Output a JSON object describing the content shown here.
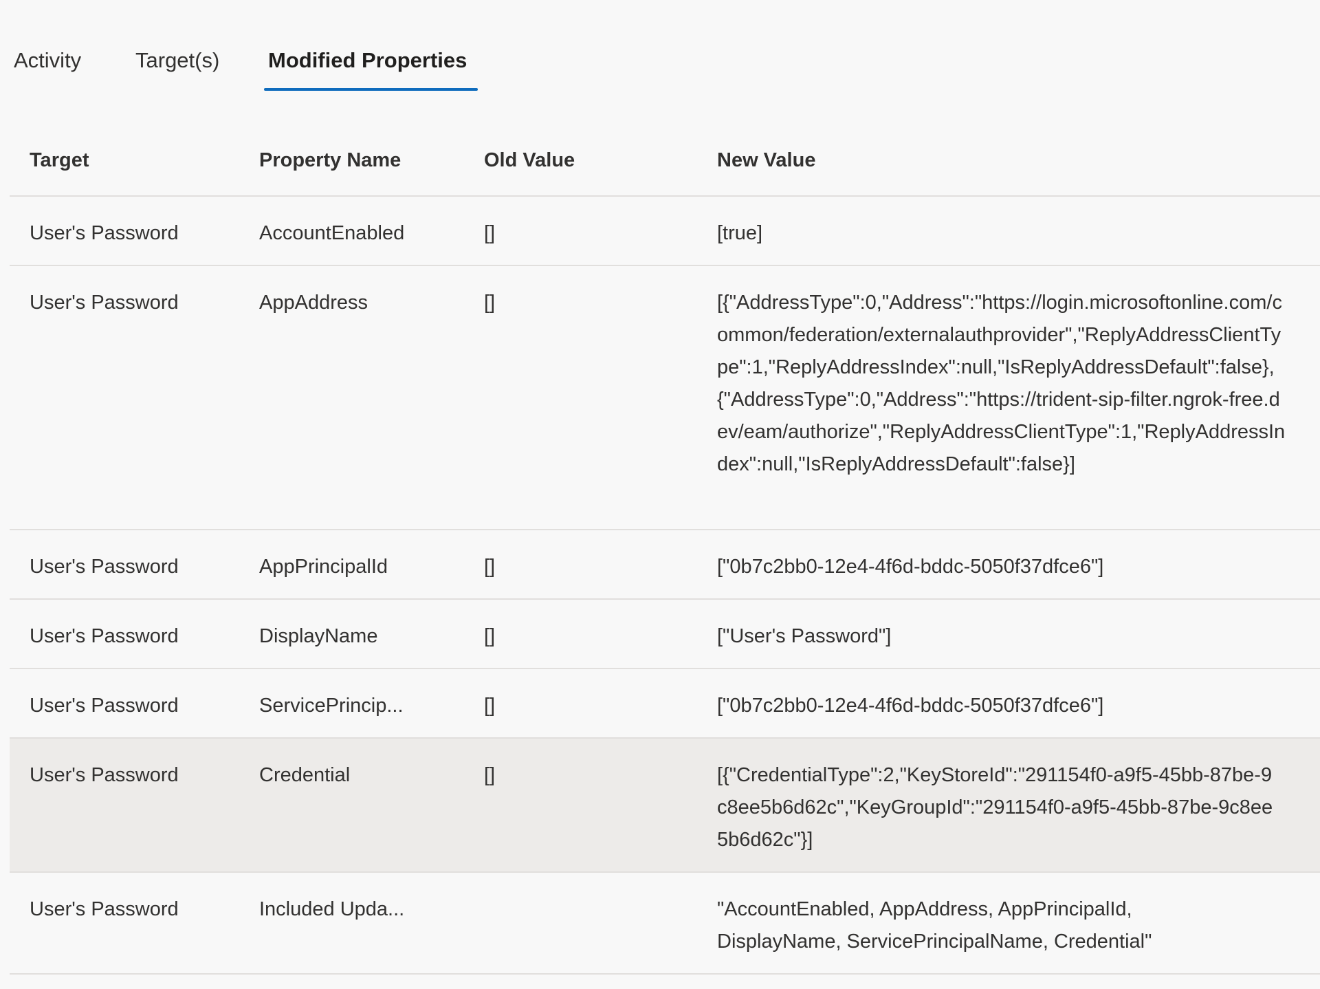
{
  "tabs": [
    {
      "label": "Activity",
      "active": false
    },
    {
      "label": "Target(s)",
      "active": false
    },
    {
      "label": "Modified Properties",
      "active": true
    }
  ],
  "table": {
    "headers": {
      "target": "Target",
      "property_name": "Property Name",
      "old_value": "Old Value",
      "new_value": "New Value"
    },
    "rows": [
      {
        "target": "User's Password",
        "property_name": "AccountEnabled",
        "old_value": "[]",
        "new_value": "[true]"
      },
      {
        "target": "User's Password",
        "property_name": "AppAddress",
        "old_value": "[]",
        "new_value": "[{\"AddressType\":0,\"Address\":\"https://login.microsoftonline.com/common/federation/externalauthprovider\",\"ReplyAddressClientType\":1,\"ReplyAddressIndex\":null,\"IsReplyAddressDefault\":false},{\"AddressType\":0,\"Address\":\"https://trident-sip-filter.ngrok-free.dev/eam/authorize\",\"ReplyAddressClientType\":1,\"ReplyAddressIndex\":null,\"IsReplyAddressDefault\":false}]"
      },
      {
        "target": "User's Password",
        "property_name": "AppPrincipalId",
        "old_value": "[]",
        "new_value": "[\"0b7c2bb0-12e4-4f6d-bddc-5050f37dfce6\"]"
      },
      {
        "target": "User's Password",
        "property_name": "DisplayName",
        "old_value": "[]",
        "new_value": "[\"User's Password\"]"
      },
      {
        "target": "User's Password",
        "property_name": "ServicePrincip...",
        "old_value": "[]",
        "new_value": "[\"0b7c2bb0-12e4-4f6d-bddc-5050f37dfce6\"]"
      },
      {
        "target": "User's Password",
        "property_name": "Credential",
        "old_value": "[]",
        "new_value": "[{\"CredentialType\":2,\"KeyStoreId\":\"291154f0-a9f5-45bb-87be-9c8ee5b6d62c\",\"KeyGroupId\":\"291154f0-a9f5-45bb-87be-9c8ee5b6d62c\"}]",
        "selected": true
      },
      {
        "target": "User's Password",
        "property_name": "Included Upda...",
        "old_value": "",
        "new_value": "\"AccountEnabled, AppAddress, AppPrincipalId, DisplayName, ServicePrincipalName, Credential\""
      }
    ]
  }
}
